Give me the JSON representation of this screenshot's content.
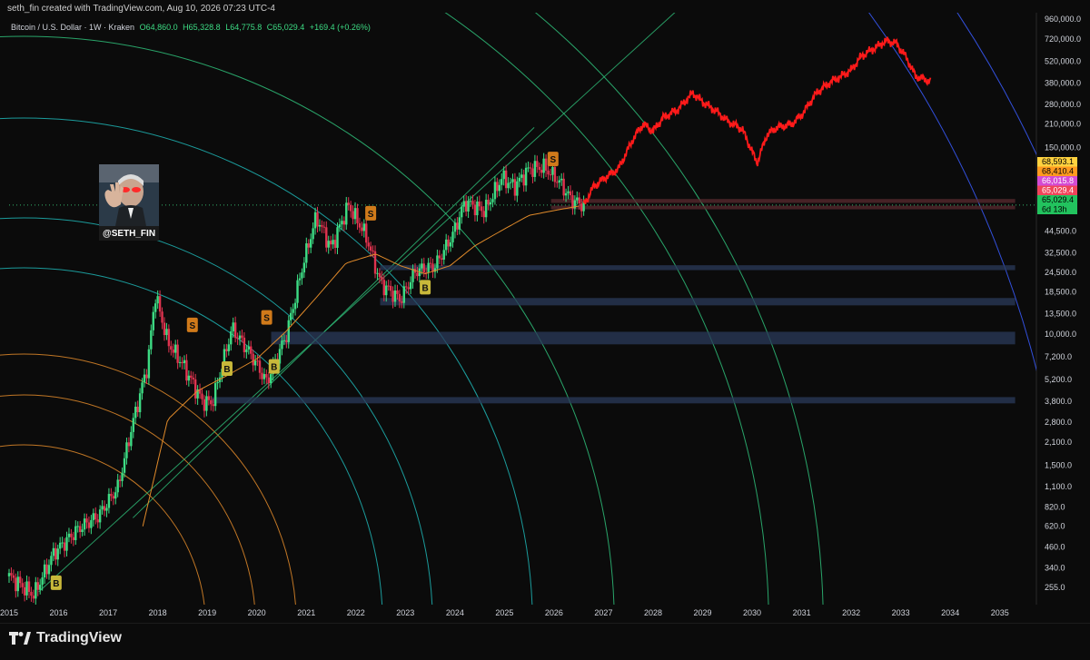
{
  "header": {
    "credit": "seth_fin created with TradingView.com, Aug 10, 2026 07:23 UTC-4",
    "symbol": "Bitcoin / U.S. Dollar · 1W · Kraken",
    "open": "O64,860.0",
    "high": "H65,328.8",
    "low": "L64,775.8",
    "close": "C65,029.4",
    "change": "+169.4 (+0.26%)"
  },
  "avatar": {
    "handle": "@SETH_FIN"
  },
  "brand": {
    "name": "TradingView",
    "icon": "tradingview-logo-icon"
  },
  "colors": {
    "background": "#0b0b0b",
    "candle_up": "#3ddc84",
    "candle_down": "#e0334f",
    "projection": "#ff1a1a",
    "ma": "#e08a2a",
    "ribbon_green": "#1f3a25",
    "ribbon_red": "#4a1824",
    "arc_orange": "#e08a2a",
    "arc_teal": "#1fb5b5",
    "arc_green": "#2fc07a",
    "arc_blue": "#3a5cff",
    "zone_blue": "#2a3a5a",
    "zone_red": "#5a2a30",
    "marker_s": "#d07a1a",
    "marker_b": "#c8b83a"
  },
  "chart_data": {
    "type": "line",
    "title": "",
    "xlabel": "",
    "ylabel": "",
    "y_scale": "log",
    "x_ticks": [
      "2015",
      "2016",
      "2017",
      "2018",
      "2019",
      "2020",
      "2021",
      "2022",
      "2023",
      "2024",
      "2025",
      "2026",
      "2027",
      "2028",
      "2029",
      "2030",
      "2031",
      "2032",
      "2033",
      "2034",
      "2035"
    ],
    "y_ticks": [
      "960,000.0",
      "720,000.0",
      "520,000.0",
      "380,000.0",
      "280,000.0",
      "210,000.0",
      "150,000.0",
      "44,500.0",
      "32,500.0",
      "24,500.0",
      "18,500.0",
      "13,500.0",
      "10,000.0",
      "7,200.0",
      "5,200.0",
      "3,800.0",
      "2,800.0",
      "2,100.0",
      "1,500.0",
      "1,100.0",
      "820.0",
      "620.0",
      "460.0",
      "340.0",
      "255.0"
    ],
    "y_tick_values": [
      960000,
      720000,
      520000,
      380000,
      280000,
      210000,
      150000,
      44500,
      32500,
      24500,
      18500,
      13500,
      10000,
      7200,
      5200,
      3800,
      2800,
      2100,
      1500,
      1100,
      820,
      620,
      460,
      340,
      255
    ],
    "ylim": [
      210,
      1000000
    ],
    "xlim": [
      2015,
      2035.5
    ],
    "price_labels": [
      {
        "text": "68,593.1",
        "value": 68593.1,
        "color": "#ffd23f",
        "text_color": "#000000"
      },
      {
        "text": "68,410.4",
        "value": 68410.4,
        "color": "#ff9a1f",
        "text_color": "#000000"
      },
      {
        "text": "66,015.8",
        "value": 66015.8,
        "color": "#d44bd4",
        "text_color": "#ffffff"
      },
      {
        "text": "65,029.4",
        "value": 65029.4,
        "color": "#f0445a",
        "text_color": "#ffffff"
      },
      {
        "text": "65,029.4",
        "value": 55000,
        "color": "#22c35e",
        "text_color": "#000000"
      },
      {
        "text": "6d 13h",
        "value": 51000,
        "color": "#22c35e",
        "text_color": "#000000"
      }
    ],
    "series": [
      {
        "kind": "history",
        "x": [
          2015.0,
          2015.5,
          2015.9,
          2016.4,
          2016.8,
          2017.2,
          2017.5,
          2017.8,
          2017.95,
          2018.2,
          2018.5,
          2018.9,
          2019.1,
          2019.5,
          2019.9,
          2020.2,
          2020.6,
          2020.95,
          2021.2,
          2021.5,
          2021.85,
          2022.2,
          2022.5,
          2022.9,
          2023.2,
          2023.6,
          2023.95,
          2024.2,
          2024.6,
          2024.95,
          2025.2,
          2025.5,
          2025.8,
          2026.1,
          2026.35,
          2026.6
        ],
        "y": [
          300,
          230,
          420,
          600,
          720,
          1100,
          2800,
          6500,
          18000,
          9000,
          6500,
          3800,
          3700,
          11000,
          7300,
          5000,
          10000,
          29000,
          55000,
          35000,
          65000,
          42000,
          21000,
          16500,
          25000,
          27000,
          42000,
          68000,
          60000,
          97000,
          85000,
          110000,
          113000,
          92000,
          70000,
          65029
        ]
      },
      {
        "kind": "projection",
        "x": [
          2026.6,
          2026.8,
          2027.0,
          2027.3,
          2027.6,
          2027.8,
          2028.0,
          2028.2,
          2028.5,
          2028.8,
          2029.0,
          2029.3,
          2029.5,
          2029.8,
          2030.1,
          2030.3,
          2030.5,
          2030.8,
          2031.0,
          2031.3,
          2031.6,
          2031.8,
          2032.0,
          2032.2,
          2032.5,
          2032.7,
          2032.9,
          2033.1,
          2033.3,
          2033.6
        ],
        "y": [
          65000,
          85000,
          95000,
          110000,
          170000,
          210000,
          190000,
          230000,
          260000,
          330000,
          290000,
          250000,
          220000,
          195000,
          120000,
          180000,
          200000,
          210000,
          240000,
          330000,
          390000,
          420000,
          460000,
          560000,
          640000,
          700000,
          680000,
          560000,
          420000,
          390000
        ]
      },
      {
        "kind": "moving-average",
        "x": [
          2017.7,
          2018.2,
          2018.8,
          2019.4,
          2020.0,
          2020.6,
          2021.2,
          2021.8,
          2022.4,
          2022.9,
          2023.4,
          2023.9,
          2024.4,
          2025.0,
          2025.5,
          2026.0,
          2026.5
        ],
        "y": [
          620,
          2900,
          4400,
          5500,
          7000,
          10500,
          17000,
          28000,
          32000,
          27000,
          24000,
          27000,
          36000,
          46000,
          56000,
          60000,
          64000
        ]
      }
    ],
    "markers": [
      {
        "label": "B",
        "x": 2015.95,
        "y": 270,
        "kind": "buy"
      },
      {
        "label": "S",
        "x": 2018.7,
        "y": 11300,
        "kind": "sell"
      },
      {
        "label": "B",
        "x": 2019.4,
        "y": 6000,
        "kind": "buy"
      },
      {
        "label": "S",
        "x": 2020.2,
        "y": 12600,
        "kind": "sell"
      },
      {
        "label": "B",
        "x": 2020.35,
        "y": 6200,
        "kind": "buy"
      },
      {
        "label": "S",
        "x": 2022.3,
        "y": 57000,
        "kind": "sell"
      },
      {
        "label": "B",
        "x": 2023.4,
        "y": 19500,
        "kind": "buy"
      },
      {
        "label": "S",
        "x": 2025.98,
        "y": 125000,
        "kind": "sell"
      }
    ],
    "zones": [
      {
        "x0": 2025.95,
        "x1": 2035.3,
        "y0": 67500,
        "y1": 70500,
        "color": "#5a2a30"
      },
      {
        "x0": 2025.95,
        "x1": 2035.3,
        "y0": 61500,
        "y1": 64000,
        "color": "#5a2a30"
      },
      {
        "x0": 2022.5,
        "x1": 2035.3,
        "y0": 25500,
        "y1": 27000,
        "color": "#2a3a5a"
      },
      {
        "x0": 2022.5,
        "x1": 2035.3,
        "y0": 15300,
        "y1": 16800,
        "color": "#2a3a5a"
      },
      {
        "x0": 2020.3,
        "x1": 2035.3,
        "y0": 8700,
        "y1": 10300,
        "color": "#2a3a5a"
      },
      {
        "x0": 2019.1,
        "x1": 2035.3,
        "y0": 3700,
        "y1": 4000,
        "color": "#2a3a5a"
      }
    ]
  }
}
